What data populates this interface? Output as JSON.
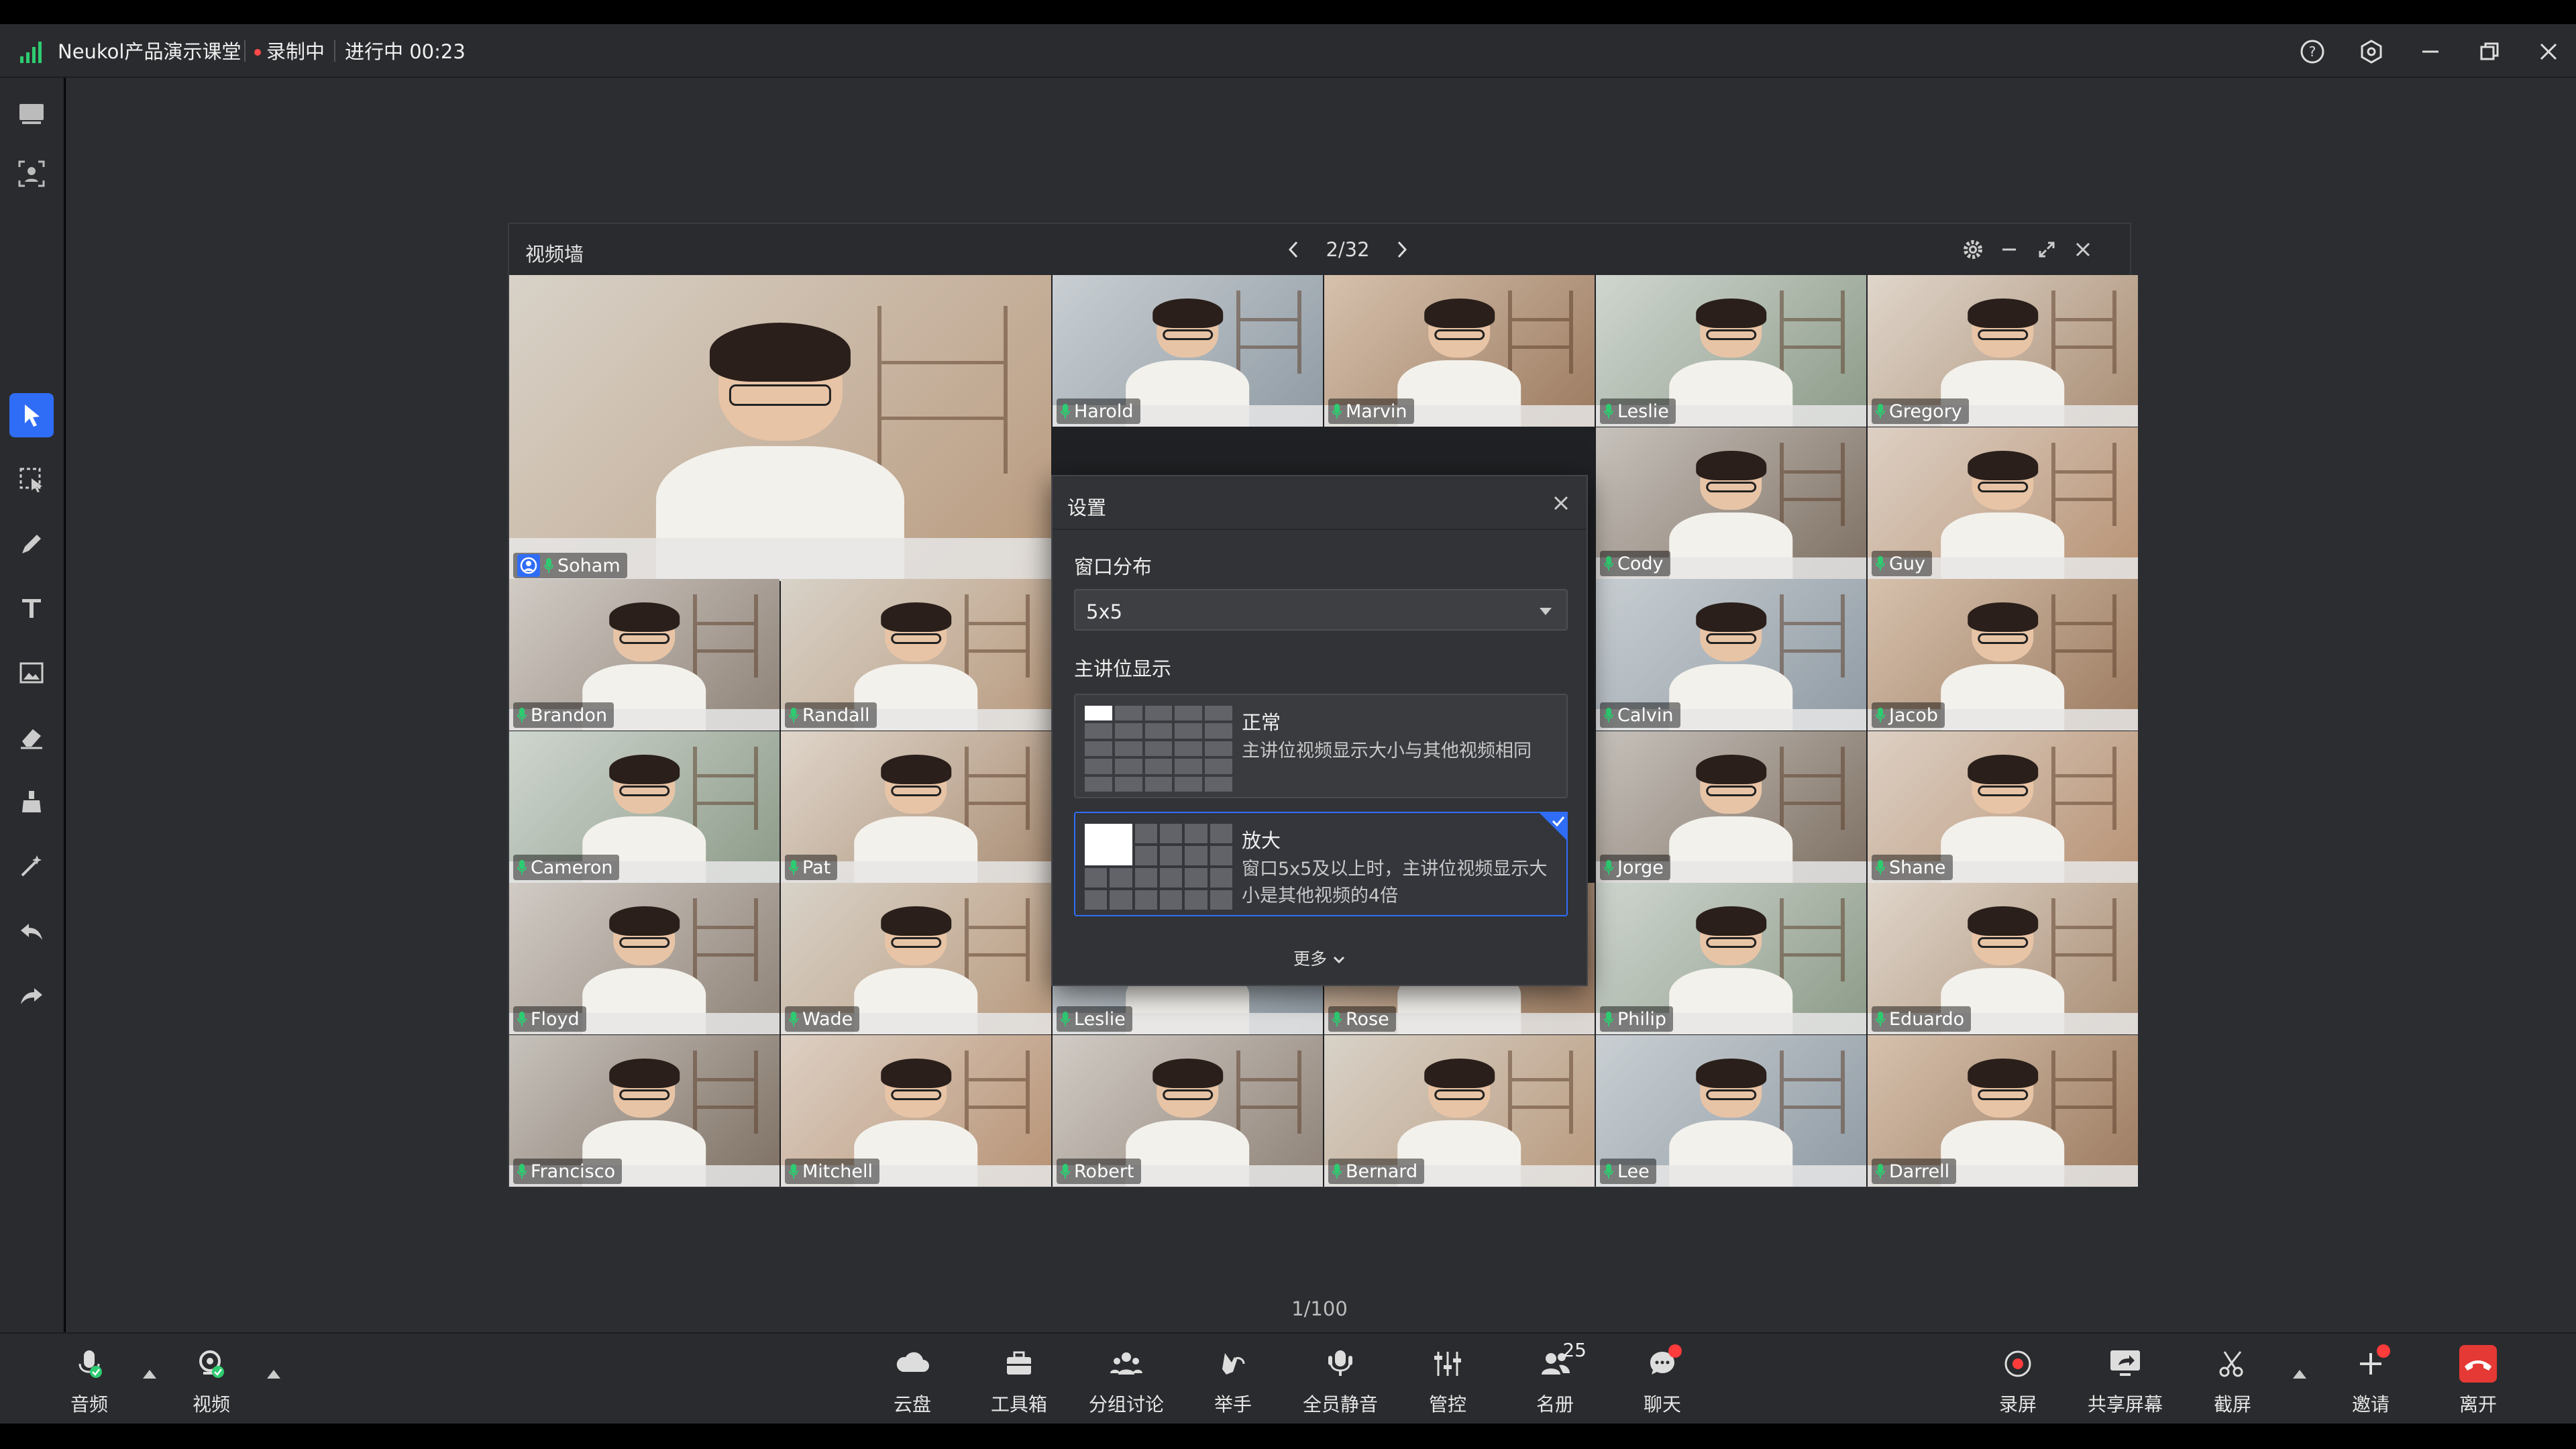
{
  "titlebar": {
    "app_title": "Neukol产品演示课堂",
    "recording_label": "录制中",
    "status": "进行中 00:23",
    "icons": [
      "help-icon",
      "settings-hex-icon",
      "minimize-icon",
      "restore-icon",
      "close-icon"
    ]
  },
  "left_rail": {
    "top_icons": [
      "whiteboard-icon",
      "face-frame-icon"
    ],
    "tools": [
      "pointer-icon",
      "select-icon",
      "pen-icon",
      "text-icon",
      "image-icon",
      "eraser-icon",
      "clear-icon",
      "magic-wand-icon",
      "undo-icon",
      "redo-icon"
    ],
    "active_tool": "pointer-icon"
  },
  "video_wall": {
    "title": "视频墙",
    "pager": "2/32",
    "main_speaker": "Soham",
    "tiles": [
      "Harold",
      "Marvin",
      "Leslie",
      "Gregory",
      "Cody",
      "Guy",
      "Brandon",
      "Randall",
      "Calvin",
      "Jacob",
      "Cameron",
      "Pat",
      "Jorge",
      "Shane",
      "Floyd",
      "Wade",
      "Leslie",
      "Rose",
      "Philip",
      "Eduardo",
      "Francisco",
      "Mitchell",
      "Robert",
      "Bernard",
      "Lee",
      "Darrell"
    ]
  },
  "settings_dialog": {
    "title": "设置",
    "layout_label": "窗口分布",
    "layout_value": "5x5",
    "speaker_label": "主讲位显示",
    "options": [
      {
        "title": "正常",
        "desc": "主讲位视频显示大小与其他视频相同",
        "selected": false
      },
      {
        "title": "放大",
        "desc": "窗口5x5及以上时，主讲位视频显示大小是其他视频的4倍",
        "selected": true
      }
    ],
    "more_label": "更多"
  },
  "page_count": "1/100",
  "toolbar": {
    "left": [
      {
        "label": "音频",
        "icon": "microphone-icon"
      },
      {
        "label": "视频",
        "icon": "camera-icon"
      }
    ],
    "center": [
      {
        "label": "云盘",
        "icon": "cloud-icon"
      },
      {
        "label": "工具箱",
        "icon": "toolbox-icon"
      },
      {
        "label": "分组讨论",
        "icon": "group-icon"
      },
      {
        "label": "举手",
        "icon": "raise-hand-icon"
      },
      {
        "label": "全员静音",
        "icon": "mute-all-icon"
      },
      {
        "label": "管控",
        "icon": "control-sliders-icon"
      },
      {
        "label": "名册",
        "icon": "roster-icon",
        "count": "25"
      },
      {
        "label": "聊天",
        "icon": "chat-icon"
      }
    ],
    "right": [
      {
        "label": "录屏",
        "icon": "record-icon"
      },
      {
        "label": "共享屏幕",
        "icon": "share-screen-icon"
      },
      {
        "label": "截屏",
        "icon": "screenshot-icon"
      },
      {
        "label": "邀请",
        "icon": "invite-plus-icon"
      },
      {
        "label": "离开",
        "icon": "leave-phone-icon"
      }
    ]
  },
  "colors": {
    "accent": "#2f6df6",
    "mic_green": "#2ecc71",
    "alert_red": "#ff3b3b",
    "leave_red": "#e53935"
  }
}
